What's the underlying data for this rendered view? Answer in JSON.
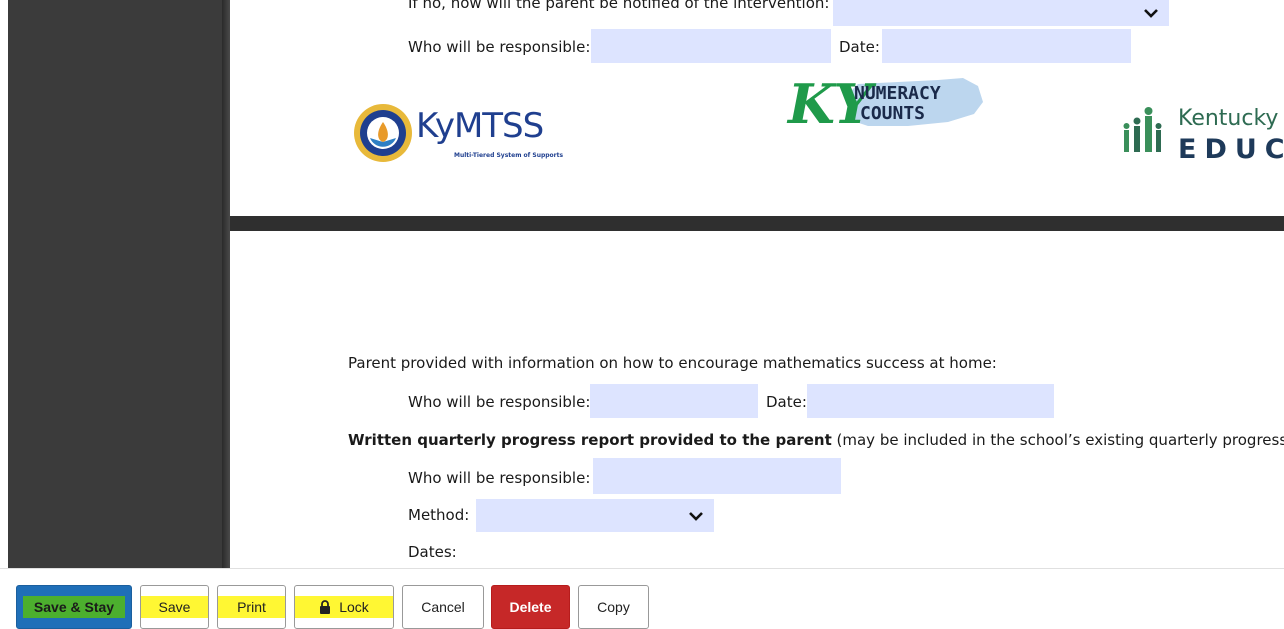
{
  "page1": {
    "partial_question": "If no, how will the parent be notified of the intervention:",
    "who_responsible_label": "Who will be responsible:",
    "date_label": "Date:",
    "logos": {
      "kymtss_main": "KyMTSS",
      "kymtss_sub": "Multi-Tiered System of Supports",
      "numeracy_ky": "KY",
      "numeracy_line1": "NUMERACY",
      "numeracy_line2": "COUNTS",
      "kde_line1": "Kentucky D",
      "kde_line2": "EDUC"
    }
  },
  "page2": {
    "parent_info_heading": "Parent provided with information on how to encourage mathematics success at home:",
    "who_responsible_label": "Who will be responsible:",
    "date_label": "Date:",
    "quarterly_heading_bold": "Written quarterly progress report provided to the parent",
    "quarterly_heading_rest": " (may be included in the school’s existing quarterly progress",
    "who_responsible_label_2": "Who will be responsible:",
    "method_label": "Method:",
    "dates_label": "Dates:"
  },
  "toolbar": {
    "save_stay": "Save & Stay",
    "save": "Save",
    "print": "Print",
    "lock": "Lock",
    "cancel": "Cancel",
    "delete": "Delete",
    "copy": "Copy"
  },
  "colors": {
    "field_bg": "#dde4ff",
    "gutter": "#3b3b3b",
    "save_stay_bg": "#1f6fb8",
    "delete_bg": "#c62828",
    "highlight_yellow": "#fff500",
    "highlight_green": "#4caf2e"
  },
  "icons": {
    "chevron": "chevron-down-icon",
    "lock": "lock-icon"
  }
}
